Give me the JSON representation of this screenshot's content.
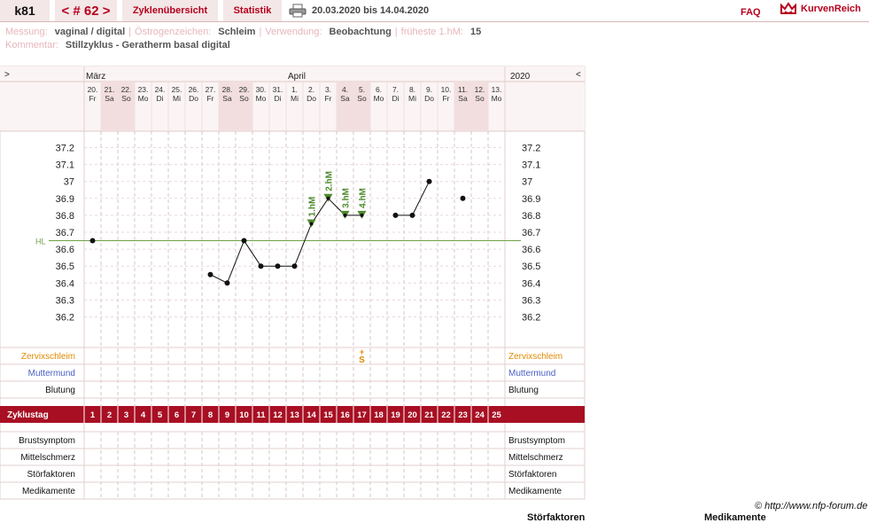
{
  "header": {
    "user": "k81",
    "cycle_nav": "< # 62 >",
    "zyklen_label": "Zyklenübersicht",
    "statistik_label": "Statistik",
    "date_range": "20.03.2020 bis 14.04.2020",
    "faq_label": "FAQ",
    "brand": "KurvenReich"
  },
  "info": {
    "messung_label": "Messung:",
    "messung": "vaginal / digital",
    "oestrogen_label": "Östrogenzeichen:",
    "oestrogen": "Schleim",
    "verwendung_label": "Verwendung:",
    "verwendung": "Beobachtung",
    "frueheste_label": "früheste 1.hM:",
    "frueheste": "15",
    "kommentar_label": "Kommentar:",
    "kommentar": "Stillzyklus - Geratherm basal digital"
  },
  "chart_data": {
    "type": "line",
    "nav_left": ">",
    "nav_right": "<",
    "year": "2020",
    "months": [
      {
        "label": "März",
        "start": 0
      },
      {
        "label": "April",
        "start": 12
      }
    ],
    "days": [
      {
        "d": "20.",
        "w": "Fr",
        "we": false
      },
      {
        "d": "21.",
        "w": "Sa",
        "we": true
      },
      {
        "d": "22.",
        "w": "So",
        "we": true
      },
      {
        "d": "23.",
        "w": "Mo",
        "we": false
      },
      {
        "d": "24.",
        "w": "Di",
        "we": false
      },
      {
        "d": "25.",
        "w": "Mi",
        "we": false
      },
      {
        "d": "26.",
        "w": "Do",
        "we": false
      },
      {
        "d": "27.",
        "w": "Fr",
        "we": false
      },
      {
        "d": "28.",
        "w": "Sa",
        "we": true
      },
      {
        "d": "29.",
        "w": "So",
        "we": true
      },
      {
        "d": "30.",
        "w": "Mo",
        "we": false
      },
      {
        "d": "31.",
        "w": "Di",
        "we": false
      },
      {
        "d": "1.",
        "w": "Mi",
        "we": false
      },
      {
        "d": "2.",
        "w": "Do",
        "we": false
      },
      {
        "d": "3.",
        "w": "Fr",
        "we": false
      },
      {
        "d": "4.",
        "w": "Sa",
        "we": true
      },
      {
        "d": "5.",
        "w": "So",
        "we": true
      },
      {
        "d": "6.",
        "w": "Mo",
        "we": false
      },
      {
        "d": "7.",
        "w": "Di",
        "we": false
      },
      {
        "d": "8.",
        "w": "Mi",
        "we": false
      },
      {
        "d": "9.",
        "w": "Do",
        "we": false
      },
      {
        "d": "10.",
        "w": "Fr",
        "we": false
      },
      {
        "d": "11.",
        "w": "Sa",
        "we": true
      },
      {
        "d": "12.",
        "w": "So",
        "we": true
      },
      {
        "d": "13.",
        "w": "Mo",
        "we": false
      }
    ],
    "y_ticks": [
      "37.2",
      "37.1",
      "37",
      "36.9",
      "36.8",
      "36.7",
      "36.6",
      "36.5",
      "36.4",
      "36.3",
      "36.2"
    ],
    "ylim": [
      36.2,
      37.2
    ],
    "hl_label": "HL",
    "hl_value": 36.65,
    "temps": [
      36.65,
      null,
      null,
      null,
      null,
      null,
      null,
      36.45,
      36.4,
      36.65,
      36.5,
      36.5,
      36.5,
      36.75,
      36.9,
      36.8,
      36.8,
      null,
      36.8,
      36.8,
      37.0,
      null,
      36.9,
      null,
      null
    ],
    "hm_markers": [
      {
        "day": 14,
        "label": "1.hM"
      },
      {
        "day": 15,
        "label": "2.hM"
      },
      {
        "day": 16,
        "label": "3.hM"
      },
      {
        "day": 17,
        "label": "4.hM"
      }
    ],
    "rows_top": [
      "Zervixschleim",
      "Muttermund",
      "Blutung"
    ],
    "row_colors": {
      "Zervixschleim": "#e08a00",
      "Muttermund": "#4a5fc4",
      "Blutung": "#111111"
    },
    "schleim_marks": [
      {
        "day": 17,
        "sym": "+",
        "code": "S"
      }
    ],
    "zyklustag_label": "Zyklustag",
    "cycle_days": [
      "1",
      "2",
      "3",
      "4",
      "5",
      "6",
      "7",
      "8",
      "9",
      "10",
      "11",
      "12",
      "13",
      "14",
      "15",
      "16",
      "17",
      "18",
      "19",
      "20",
      "21",
      "22",
      "23",
      "24",
      "25"
    ],
    "rows_bottom": [
      "Brustsymptom",
      "Mittelschmerz",
      "Störfaktoren",
      "Medikamente"
    ]
  },
  "footer": {
    "copyright": "© http://www.nfp-forum.de",
    "bottom_left": "Störfaktoren",
    "bottom_right": "Medikamente"
  }
}
